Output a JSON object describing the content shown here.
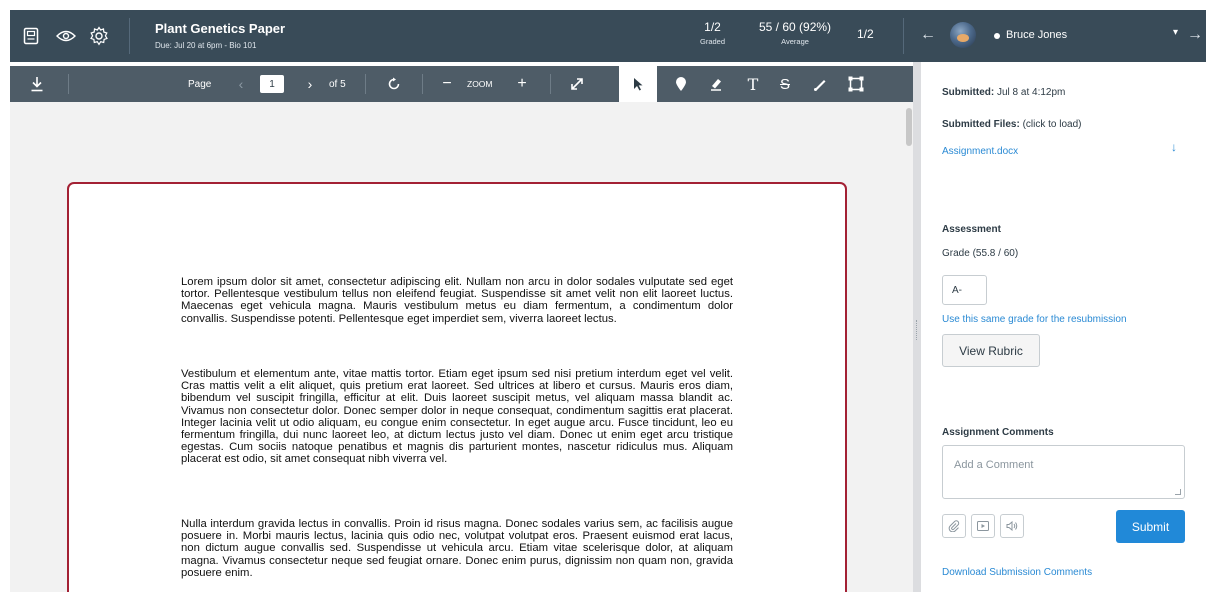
{
  "header": {
    "assignment_title": "Plant Genetics Paper",
    "assignment_sub": "Due: Jul 20 at 6pm - Bio 101",
    "graded_count": "1/2",
    "graded_label": "Graded",
    "average_value": "55 / 60 (92%)",
    "average_label": "Average",
    "submission_position": "1/2",
    "student_name": "Bruce Jones"
  },
  "toolbar": {
    "page_label": "Page",
    "page_number": "1",
    "page_total": "of 5",
    "zoom_label": "ZOOM"
  },
  "document": {
    "paragraphs": [
      "Lorem ipsum dolor sit amet, consectetur adipiscing elit. Nullam non arcu in dolor sodales vulputate sed eget tortor. Pellentesque vestibulum tellus non eleifend feugiat. Suspendisse sit amet velit non elit laoreet luctus. Maecenas eget vehicula magna. Mauris vestibulum metus eu diam fermentum, a condimentum dolor convallis. Suspendisse potenti. Pellentesque eget imperdiet sem, viverra laoreet lectus.",
      "Vestibulum et elementum ante, vitae mattis tortor. Etiam eget ipsum sed nisi pretium interdum eget vel velit. Cras mattis velit a elit aliquet, quis pretium erat laoreet. Sed ultrices at libero et cursus. Mauris eros diam, bibendum vel suscipit fringilla, efficitur at elit. Duis laoreet suscipit metus, vel aliquam massa blandit ac. Vivamus non consectetur dolor. Donec semper dolor in neque consequat, condimentum sagittis erat placerat. Integer lacinia velit ut odio aliquam, eu congue enim consectetur. In eget augue arcu. Fusce tincidunt, leo eu fermentum fringilla, dui nunc laoreet leo, at dictum lectus justo vel diam. Donec ut enim eget arcu tristique egestas. Cum sociis natoque penatibus et magnis dis parturient montes, nascetur ridiculus mus. Aliquam placerat est odio, sit amet consequat nibh viverra vel.",
      "Nulla interdum gravida lectus in convallis. Proin id risus magna. Donec sodales varius sem, ac facilisis augue posuere in. Morbi mauris lectus, lacinia quis odio nec, volutpat volutpat eros. Praesent euismod erat lacus, non dictum augue convallis sed. Suspendisse ut vehicula arcu. Etiam vitae scelerisque dolor, at aliquam magna. Vivamus consectetur neque sed feugiat ornare. Donec enim purus, dignissim non quam non, gravida posuere enim."
    ]
  },
  "sidebar": {
    "submitted_label": "Submitted:",
    "submitted_value": "Jul 8 at 4:12pm",
    "files_label": "Submitted Files:",
    "files_hint": "(click to load)",
    "file_name": "Assignment.docx",
    "assessment_heading": "Assessment",
    "grade_text": "Grade (55.8 / 60)",
    "grade_value": "A-",
    "same_grade_link": "Use this same grade for the resubmission",
    "view_rubric_label": "View Rubric",
    "comments_heading": "Assignment Comments",
    "comment_placeholder": "Add a Comment",
    "submit_label": "Submit",
    "download_comments_link": "Download Submission Comments"
  },
  "colors": {
    "header_bg": "#394b58",
    "toolbar_bg": "#4e5c67",
    "accent_link": "#2a8ad4",
    "submit_button": "#2189d8",
    "page_border": "#a32134"
  }
}
